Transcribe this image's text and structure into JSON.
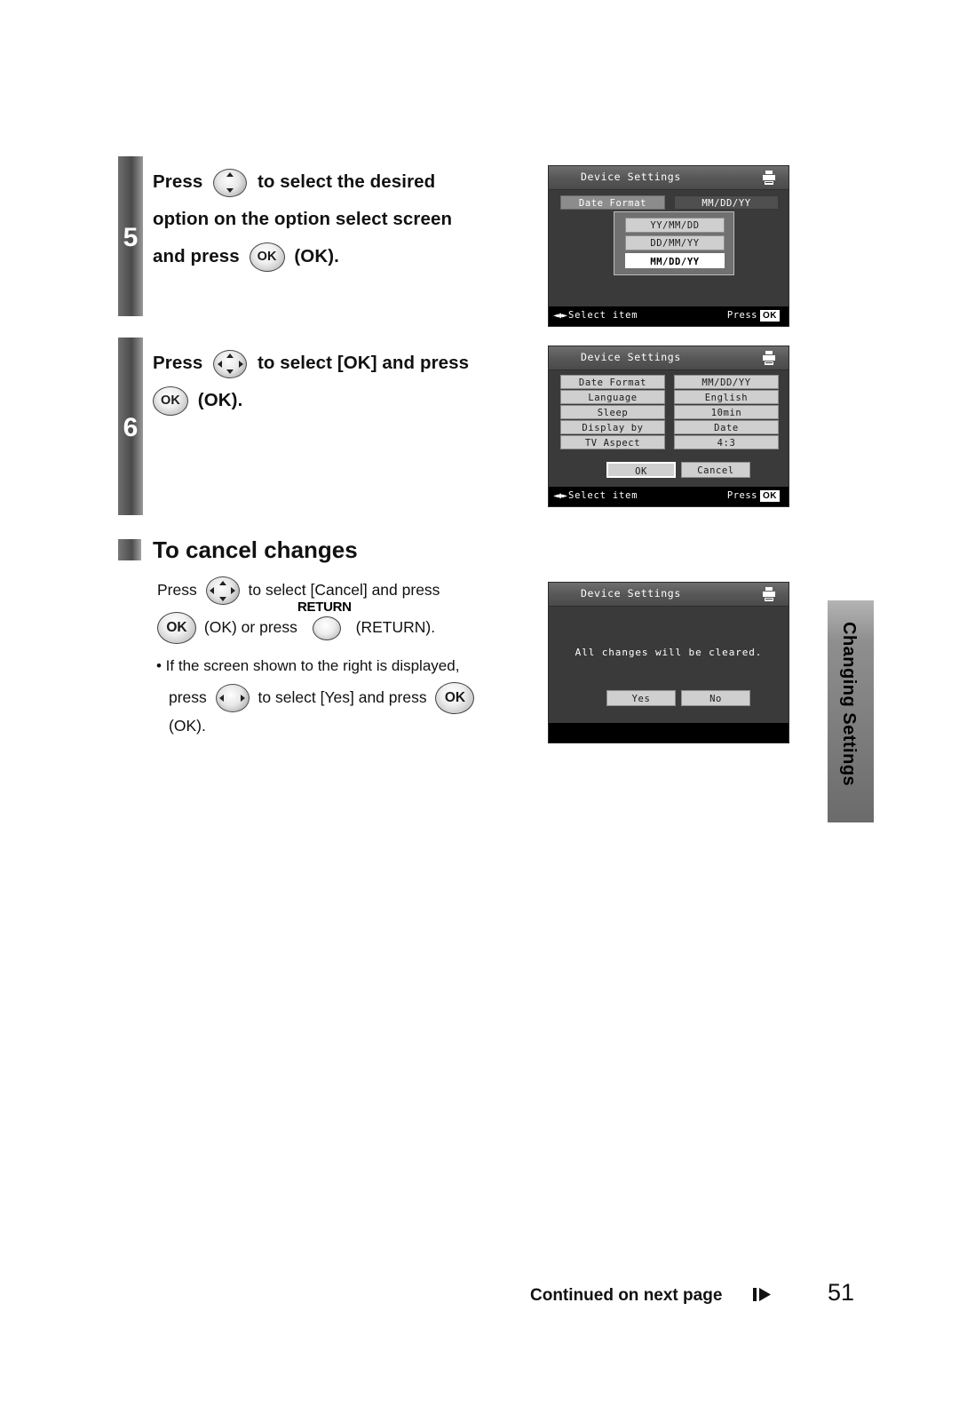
{
  "steps": [
    {
      "number": "5",
      "line1_a": "Press",
      "line1_b": "to select the desired",
      "line2": "option on the option select screen",
      "line3_a": "and press",
      "line3_b": "(OK)."
    },
    {
      "number": "6",
      "line1_a": "Press",
      "line1_b": "to select [OK] and press",
      "line2_b": "(OK)."
    }
  ],
  "section": {
    "title": "To cancel changes",
    "p1_a": "Press",
    "p1_b": "to select [Cancel] and press",
    "p2_a": "(OK) or press",
    "p2_return_label": "RETURN",
    "p2_b": "(RETURN).",
    "bullet1": "• If the screen shown to the right is displayed,",
    "bullet2_a": "press",
    "bullet2_b": "to select [Yes] and press",
    "bullet3": "(OK)."
  },
  "lcd5": {
    "title": "Device Settings",
    "row_label": "Date Format",
    "row_value": "MM/DD/YY",
    "options": [
      "YY/MM/DD",
      "DD/MM/YY",
      "MM/DD/YY"
    ],
    "selected_option": "MM/DD/YY",
    "hint_left": "Select item",
    "hint_right": "Press",
    "hint_ok": "OK"
  },
  "lcd6": {
    "title": "Device Settings",
    "rows": [
      {
        "label": "Date Format",
        "value": "MM/DD/YY"
      },
      {
        "label": "Language",
        "value": "English"
      },
      {
        "label": "Sleep",
        "value": "10min"
      },
      {
        "label": "Display by",
        "value": "Date"
      },
      {
        "label": "TV Aspect",
        "value": "4:3"
      }
    ],
    "ok_label": "OK",
    "cancel_label": "Cancel",
    "hint_left": "Select item",
    "hint_right": "Press",
    "hint_ok": "OK"
  },
  "lcd_cancel": {
    "title": "Device Settings",
    "message": "All changes will be cleared.",
    "yes_label": "Yes",
    "no_label": "No"
  },
  "sidetab": {
    "label": "Changing Settings"
  },
  "footer": {
    "continued": "Continued on next page",
    "page": "51"
  }
}
